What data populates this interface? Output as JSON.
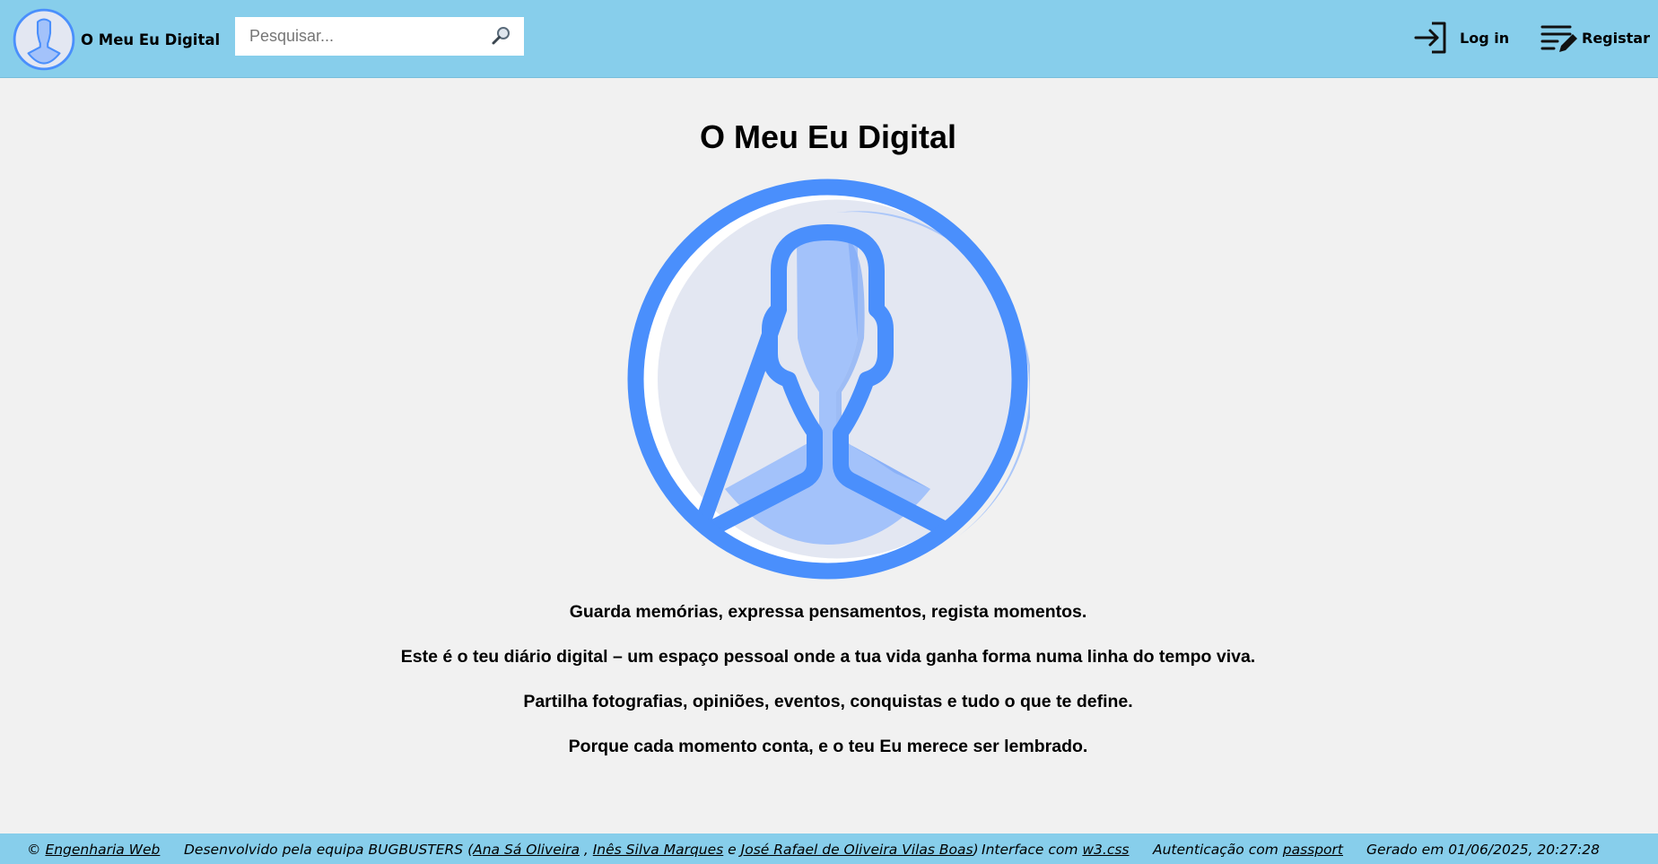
{
  "header": {
    "brand_title": "O Meu Eu Digital",
    "search_placeholder": "Pesquisar...",
    "login_label": "Log in",
    "register_label": "Registar"
  },
  "main": {
    "title": "O Meu Eu Digital",
    "paragraphs": [
      "Guarda memórias, expressa pensamentos, regista momentos.",
      "Este é o teu diário digital – um espaço pessoal onde a tua vida ganha forma numa linha do tempo viva.",
      "Partilha fotografias, opiniões, eventos, conquistas e tudo o que te define.",
      "Porque cada momento conta, e o teu Eu merece ser lembrado."
    ]
  },
  "footer": {
    "copyright_symbol": "©",
    "course_link": "Engenharia Web",
    "team_prefix": "Desenvolvido pela equipa BUGBUSTERS (",
    "members": [
      "Ana Sá Oliveira",
      "Inês Silva Marques",
      "José Rafael de Oliveira Vilas Boas"
    ],
    "member_sep_1": " , ",
    "member_sep_2": " e ",
    "team_suffix": ")",
    "interface_prefix": "Interface com ",
    "interface_link": "w3.css",
    "auth_prefix": "Autenticação com ",
    "auth_link": "passport",
    "generated": "Gerado em 01/06/2025, 20:27:28"
  },
  "colors": {
    "topbar_bg": "#87ceeb",
    "page_bg": "#f1f1f1",
    "avatar_outline": "#4a8ffc",
    "avatar_fill": "#a3c2fa",
    "avatar_bg": "#e3e7f2"
  },
  "icons": {
    "brand": "user-avatar-icon",
    "search": "magnifier-icon",
    "login": "sign-in-icon",
    "register": "edit-list-icon"
  }
}
